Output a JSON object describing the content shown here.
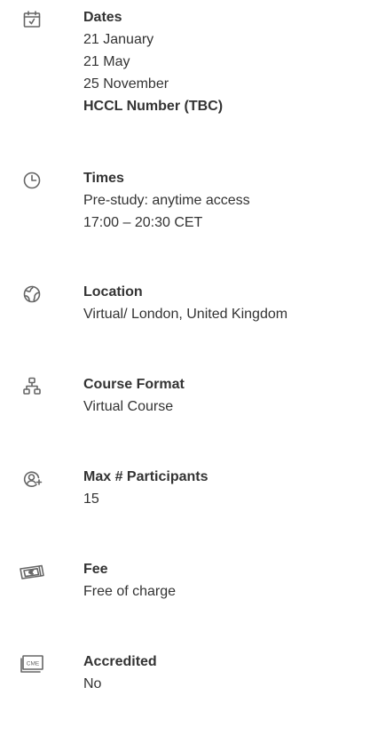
{
  "sections": {
    "dates": {
      "title": "Dates",
      "lines": [
        "21 January",
        "21 May",
        "25 November"
      ],
      "note": "HCCL Number (TBC)",
      "icon": "calendar-icon"
    },
    "times": {
      "title": "Times",
      "lines": [
        "Pre-study: anytime access",
        "17:00 – 20:30 CET"
      ],
      "icon": "clock-icon"
    },
    "location": {
      "title": "Location",
      "lines": [
        "Virtual/ London, United Kingdom"
      ],
      "icon": "globe-icon"
    },
    "course_format": {
      "title": "Course Format",
      "lines": [
        "Virtual Course"
      ],
      "icon": "hierarchy-icon"
    },
    "max_participants": {
      "title": "Max # Participants",
      "lines": [
        "15"
      ],
      "icon": "add-user-icon"
    },
    "fee": {
      "title": "Fee",
      "lines": [
        "Free of charge"
      ],
      "icon": "euro-banknote-icon"
    },
    "accredited": {
      "title": "Accredited",
      "lines": [
        "No"
      ],
      "icon": "cme-certificate-icon",
      "icon_text": "CME"
    }
  },
  "colors": {
    "text": "#333333",
    "icon": "#666666"
  }
}
